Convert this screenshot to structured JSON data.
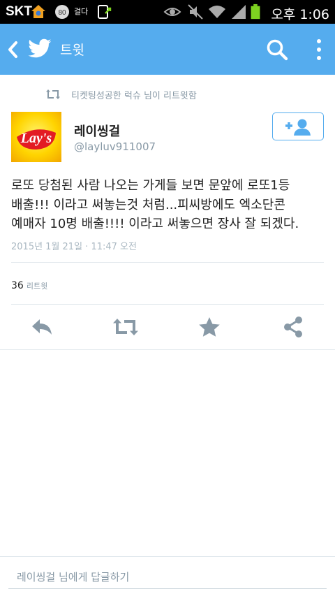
{
  "status_bar": {
    "carrier": "SKT",
    "time": "오후 1:06",
    "icons": [
      "home-notification-icon",
      "badge-80-icon",
      "app-notification-icon",
      "download-icon",
      "eye-icon",
      "mute-icon",
      "wifi-icon",
      "signal-icon",
      "battery-icon"
    ],
    "badge_80": "80",
    "app_notify_label": "걸다"
  },
  "header": {
    "title": "트윗",
    "accent": "#55acee"
  },
  "tweet": {
    "retweeted_by": "티켓팅성공한 럭슈 님이 리트윗함",
    "author_name": "레이씽걸",
    "author_handle": "@layluv911007",
    "avatar_label": "Lay's",
    "text_lines": [
      "로또 당첨된 사람 나오는 가게들 보면 문앞에 로또1등",
      "배출!!! 이라고 써놓는것 처럼...피씨방에도 엑소단콘",
      "예매자 10명 배출!!!! 이라고 써놓으면 장사 잘 되겠다."
    ],
    "timestamp": "2015년 1월 21일 · 11:47 오전",
    "retweet_count": "36",
    "retweet_label": "리트윗"
  },
  "actions": [
    "reply-icon",
    "retweet-icon",
    "favorite-icon",
    "share-icon"
  ],
  "reply": {
    "placeholder": "레이씽걸 님에게 답글하기"
  }
}
